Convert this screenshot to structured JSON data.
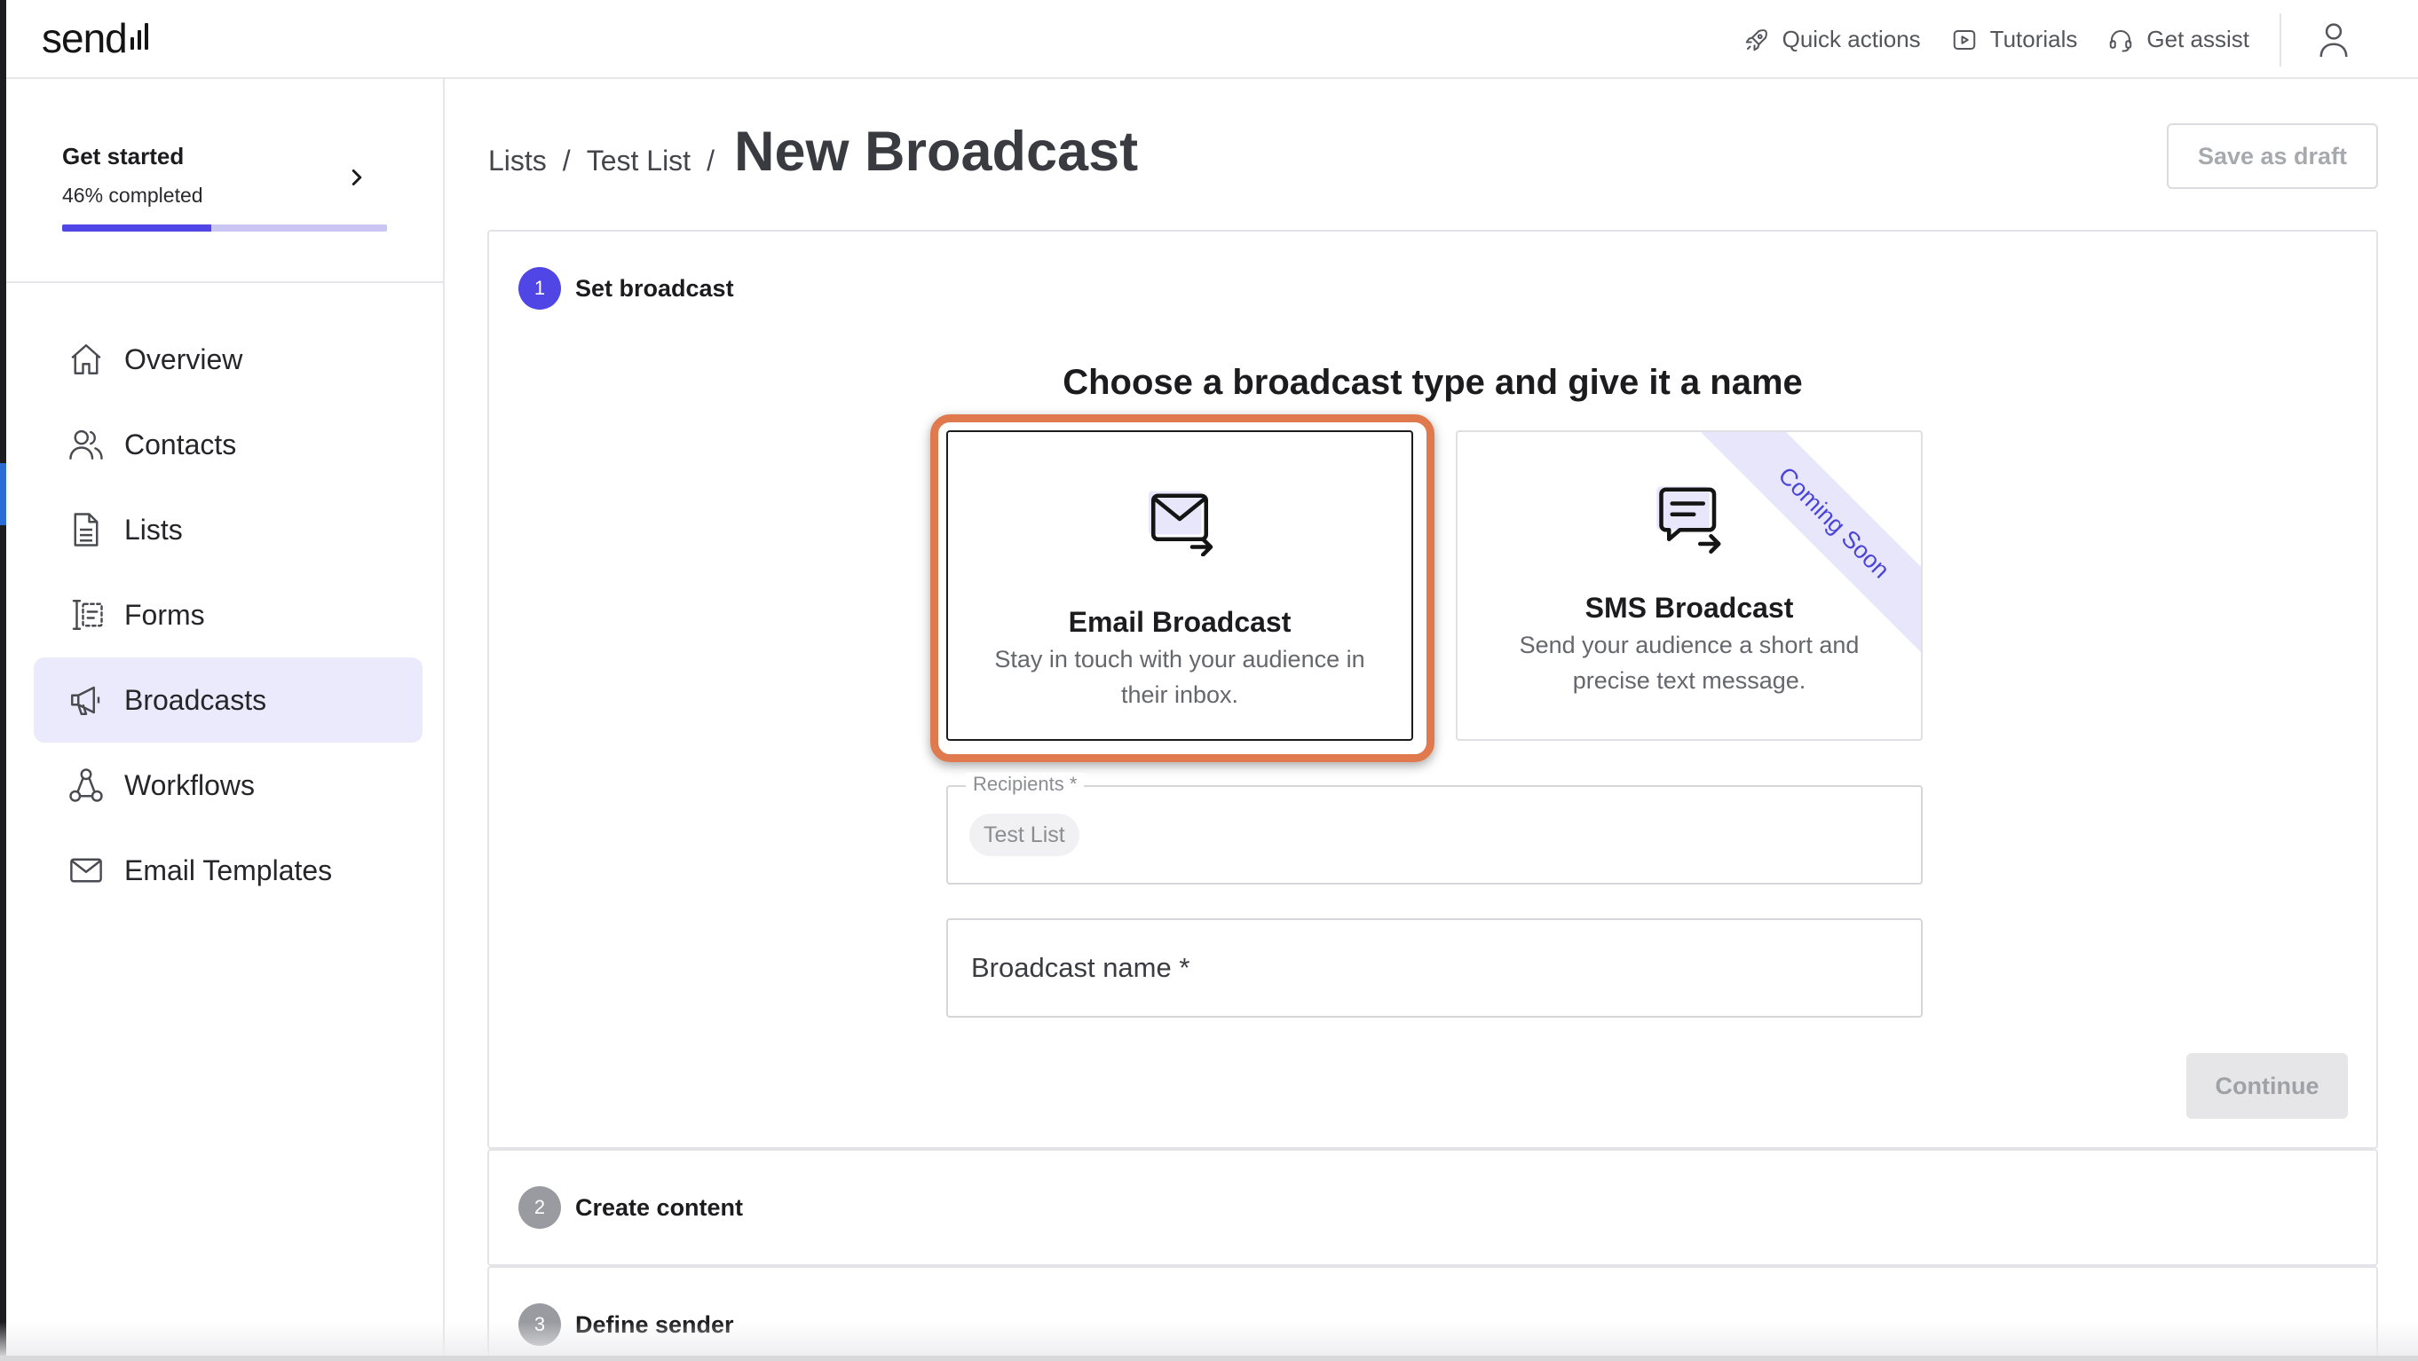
{
  "header": {
    "logo_text": "send",
    "quick_actions": "Quick actions",
    "tutorials": "Tutorials",
    "get_assist": "Get assist",
    "icons": [
      "rocket-icon",
      "play-icon",
      "headset-icon",
      "user-icon"
    ]
  },
  "sidebar": {
    "get_started": {
      "title": "Get started",
      "progress_text": "46% completed",
      "progress_fraction": 0.46
    },
    "items": [
      {
        "label": "Overview",
        "icon": "home-icon"
      },
      {
        "label": "Contacts",
        "icon": "users-icon"
      },
      {
        "label": "Lists",
        "icon": "document-icon"
      },
      {
        "label": "Forms",
        "icon": "form-icon"
      },
      {
        "label": "Broadcasts",
        "icon": "megaphone-icon",
        "active": true
      },
      {
        "label": "Workflows",
        "icon": "workflow-icon"
      },
      {
        "label": "Email Templates",
        "icon": "mail-icon"
      }
    ]
  },
  "breadcrumb": {
    "items": [
      "Lists",
      "Test List"
    ],
    "separator": "/",
    "current": "New Broadcast"
  },
  "actions": {
    "save_draft": "Save as draft",
    "continue": "Continue"
  },
  "steps": [
    {
      "number": "1",
      "title": "Set broadcast"
    },
    {
      "number": "2",
      "title": "Create content"
    },
    {
      "number": "3",
      "title": "Define sender"
    }
  ],
  "broadcast_type": {
    "heading": "Choose a broadcast type and give it a name",
    "email": {
      "title": "Email Broadcast",
      "description": "Stay in touch with your audience in their inbox.",
      "icon": "mail-send-icon"
    },
    "sms": {
      "title": "SMS Broadcast",
      "description": "Send your audience a short and precise text message.",
      "ribbon": "Coming Soon",
      "icon": "message-send-icon"
    }
  },
  "form": {
    "recipients_label": "Recipients *",
    "recipients_chip": "Test List",
    "broadcast_name_label": "Broadcast name *"
  },
  "colors": {
    "accent": "#4f46e5",
    "accent_light": "#ebe9fc",
    "highlight": "#e07a4e"
  }
}
